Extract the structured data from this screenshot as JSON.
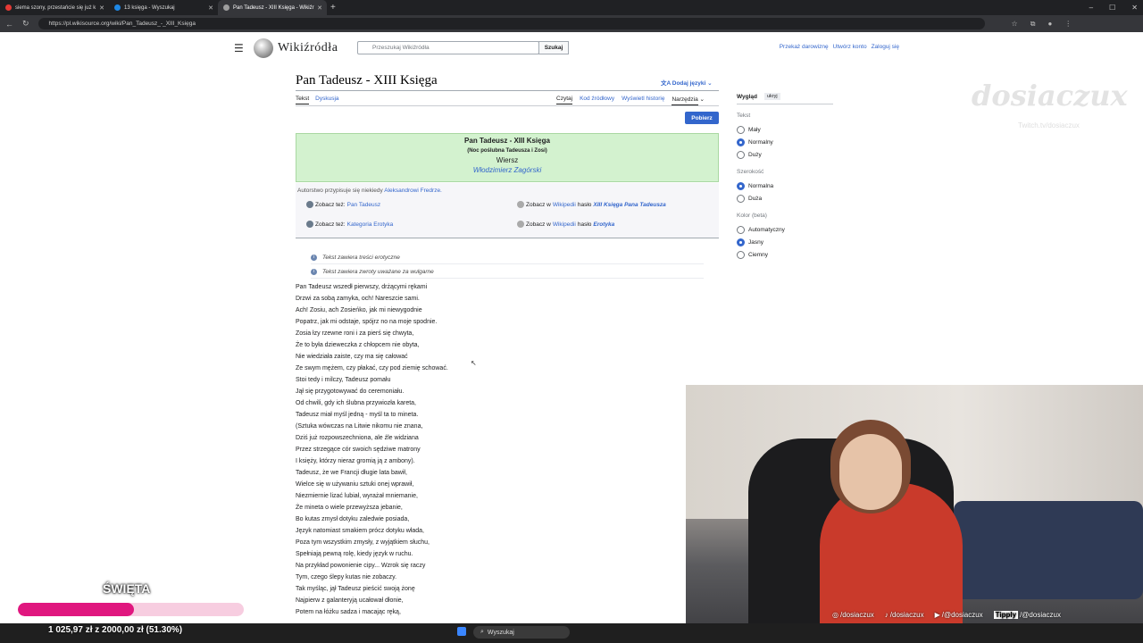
{
  "browser": {
    "tabs": [
      {
        "title": "siema szony, przestańcie się już k",
        "color": "#e53935"
      },
      {
        "title": "13 księga - Wyszukaj",
        "color": "#1e88e5"
      },
      {
        "title": "Pan Tadeusz - XIII Księga - Wikiźr",
        "color": "#9e9e9e",
        "active": true
      }
    ],
    "new_tab": "+",
    "url": "https://pl.wikisource.org/wiki/Pan_Tadeusz_-_XIII_Księga"
  },
  "wiki": {
    "logo": "Wikiźródła",
    "search_placeholder": "Przeszukaj Wikiźródła",
    "search_button": "Szukaj",
    "user_links": [
      "Przekaż darowiznę",
      "Utwórz konto",
      "Zaloguj się"
    ],
    "page_title": "Pan Tadeusz - XIII Księga",
    "lang_button": "Dodaj języki",
    "tabs_left": [
      "Tekst",
      "Dyskusja"
    ],
    "tabs_right": [
      "Czytaj",
      "Kod źródłowy",
      "Wyświetl historię",
      "Narzędzia"
    ],
    "download": "Pobierz",
    "header": {
      "title": "Pan Tadeusz - XIII Księga",
      "subtitle": "(Noc poślubna Tadeusza i Zosi)",
      "genre": "Wiersz",
      "author": "Włodzimierz Zagórski"
    },
    "attribution_prefix": "Autorstwo przypisuje się niekiedy",
    "attribution_link": "Aleksandrowi Fredrze.",
    "refs": {
      "see_also_1_label": "Zobacz też:",
      "see_also_1_link": "Pan Tadeusz",
      "see_also_2_label": "Zobacz też:",
      "see_also_2_link": "Kategoria Erotyka",
      "wiki_1_prefix": "Zobacz w",
      "wiki_1_link": "Wikipedii",
      "wiki_1_mid": "hasło",
      "wiki_1_bold": "XIII Księga Pana Tadeusza",
      "wiki_2_prefix": "Zobacz w",
      "wiki_2_link": "Wikipedii",
      "wiki_2_mid": "hasło",
      "wiki_2_bold": "Erotyka"
    },
    "warnings": [
      "Tekst zawiera treści erotyczne",
      "Tekst zawiera zwroty uważane za wulgarne"
    ],
    "poem": [
      "Pan Tadeusz wszedł pierwszy, drżącymi rękami",
      "Drzwi za sobą zamyka, och! Nareszcie sami.",
      "Ach! Zosiu, ach Zosieńko, jak mi niewygodnie",
      "Popatrz, jak mi odstaje, spójrz no na moje spodnie.",
      "Zosia łzy rzewne roni i za pierś się chwyta,",
      "Że to była dzieweczka z chłopcem nie obyta,",
      "Nie wiedziała zaiste, czy ma się całować",
      "Ze swym mężem, czy płakać, czy pod ziemię schować.",
      "Stoi tedy i milczy, Tadeusz pomału",
      "Jął się przygotowywać do ceremoniału.",
      "Od chwili, gdy ich ślubna przywiozła kareta,",
      "Tadeusz miał myśl jedną - myśl ta to mineta.",
      "(Sztuka wówczas na Litwie nikomu nie znana,",
      "Dziś już rozpowszechniona, ale źle widziana",
      "Przez strzegące cór swoich sędziwe matrony",
      "I księży, którzy nieraz gromią ją z ambony).",
      "Tadeusz, że we Francji długie lata bawił,",
      "Wielce się w używaniu sztuki onej wprawił,",
      "Niezmiernie lizać lubiał, wyrażał mniemanie,",
      "Że mineta o wiele przewyższa jebanie,",
      "Bo kutas zmysł dotyku zaledwie posiada,",
      "Język natomiast smakiem prócz dotyku włada,",
      "Poza tym wszystkim zmysły, z wyjątkiem słuchu,",
      "Spełniają pewną rolę, kiedy język w ruchu.",
      "Na przykład powonienie cipy... Wzrok się raczy",
      "Tym, czego ślepy kutas nie zobaczy.",
      "Tak myśląc, jął Tadeusz pieścić swoją żonę",
      "Najpierw z galanteryją ucałował dłonie,",
      "Potem na łóżku sadza i macając ręką,"
    ],
    "sidebar": {
      "title": "Wygląd",
      "hide": "ukryj",
      "groups": [
        {
          "label": "Tekst",
          "options": [
            "Mały",
            "Normalny",
            "Duży"
          ],
          "selected": 1
        },
        {
          "label": "Szerokość",
          "options": [
            "Normalna",
            "Duża"
          ],
          "selected": 0
        },
        {
          "label": "Kolor (beta)",
          "options": [
            "Automatyczny",
            "Jasny",
            "Ciemny"
          ],
          "selected": 1
        }
      ]
    }
  },
  "stream": {
    "watermark": "dosiaczux",
    "watermark_sub": "Twitch.tv/dosiaczux",
    "goal_title": "ŚWIĘTA",
    "goal_amount": "1 025,97 zł z 2000,00 zł (51.30%)",
    "goal_fraction": 0.513,
    "socials": [
      "/dosiaczux",
      "/dosiaczux",
      "/@dosiaczux",
      "/@dosiaczux"
    ],
    "social_icons": [
      "instagram-icon",
      "tiktok-icon",
      "youtube-icon",
      "tipply-icon"
    ],
    "tipply_label": "Tipply"
  },
  "taskbar": {
    "search": "Wyszukaj"
  }
}
